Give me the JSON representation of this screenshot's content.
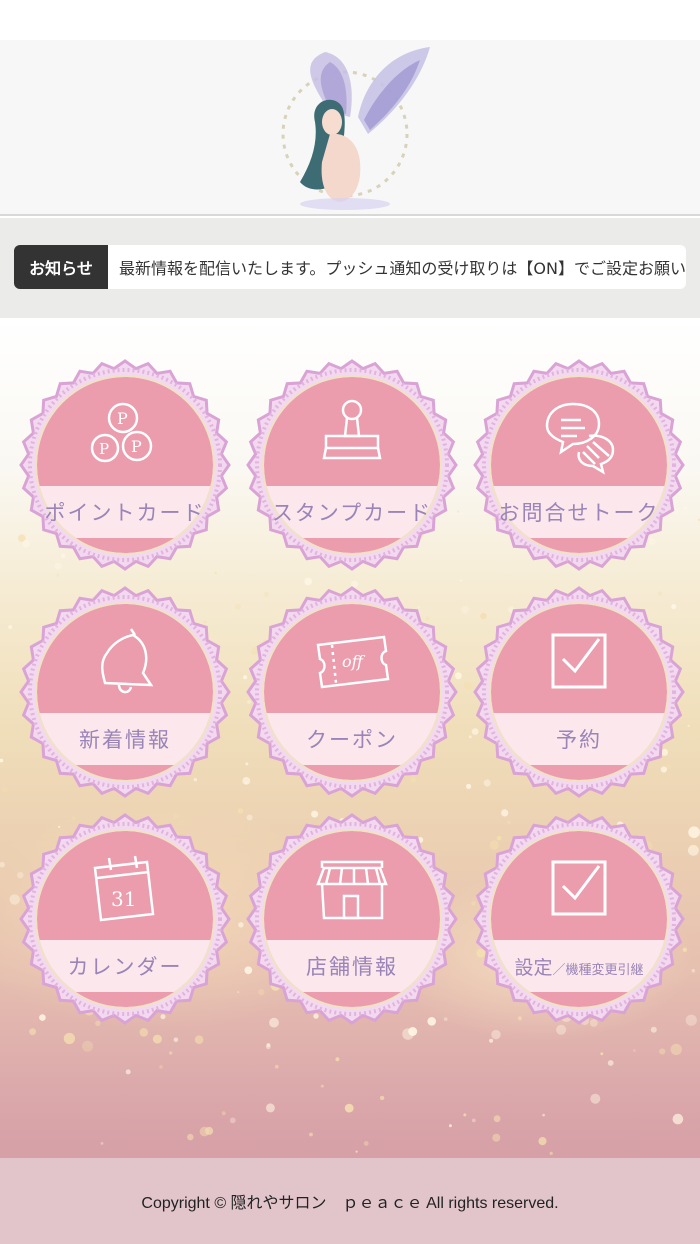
{
  "notice": {
    "label": "お知らせ",
    "text": "最新情報を配信いたします。プッシュ通知の受け取りは【ON】でご設定お願いします。"
  },
  "menu": [
    {
      "label": "ポイントカード",
      "icon": "point-coins-icon"
    },
    {
      "label": "スタンプカード",
      "icon": "stamp-icon"
    },
    {
      "label": "お問合せトーク",
      "icon": "chat-bubbles-icon"
    },
    {
      "label": "新着情報",
      "icon": "bell-icon"
    },
    {
      "label": "クーポン",
      "icon": "coupon-ticket-icon"
    },
    {
      "label": "予約",
      "icon": "checkbox-icon"
    },
    {
      "label": "カレンダー",
      "icon": "calendar-icon"
    },
    {
      "label": "店舗情報",
      "icon": "storefront-icon"
    },
    {
      "label": "設定",
      "sub_label": "／機種変更引継",
      "icon": "checkbox-icon"
    }
  ],
  "footer": {
    "copyright": "Copyright © 隠れやサロン　ｐｅａｃｅ All rights reserved."
  },
  "colors": {
    "tile_pink": "#eb9cad",
    "tile_band": "#fbe7ec",
    "tile_border": "#d9a3d6",
    "label_purple": "#9a84b8",
    "notice_label_bg": "#333333"
  }
}
